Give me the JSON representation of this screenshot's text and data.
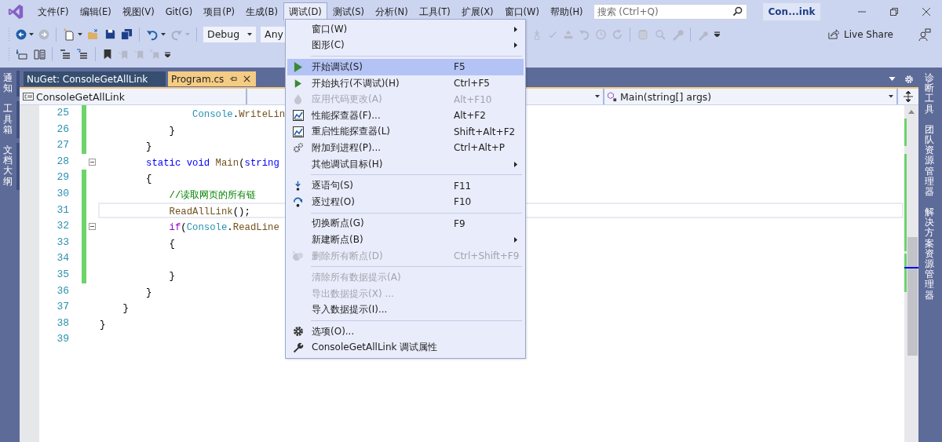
{
  "menu_bar": {
    "items": [
      {
        "label": "文件(F)",
        "selected": false
      },
      {
        "label": "编辑(E)",
        "selected": false
      },
      {
        "label": "视图(V)",
        "selected": false
      },
      {
        "label": "Git(G)",
        "selected": false
      },
      {
        "label": "项目(P)",
        "selected": false
      },
      {
        "label": "生成(B)",
        "selected": false
      },
      {
        "label": "调试(D)",
        "selected": true
      },
      {
        "label": "测试(S)",
        "selected": false
      },
      {
        "label": "分析(N)",
        "selected": false
      },
      {
        "label": "工具(T)",
        "selected": false
      },
      {
        "label": "扩展(X)",
        "selected": false
      },
      {
        "label": "窗口(W)",
        "selected": false
      },
      {
        "label": "帮助(H)",
        "selected": false
      }
    ]
  },
  "search": {
    "placeholder": "搜索 (Ctrl+Q)"
  },
  "solution_name": "Con...ink",
  "toolbar": {
    "configuration": "Debug",
    "platform": "Any",
    "live_share": "Live Share"
  },
  "left_panels": [
    "通知",
    "工具箱",
    "文档大纲"
  ],
  "right_panels": [
    "诊断工具",
    "团队资源管理器",
    "解决方案资源管理器"
  ],
  "tabs": [
    {
      "label": "NuGet: ConsoleGetAllLink",
      "selected": false
    },
    {
      "label": "Program.cs",
      "selected": true
    }
  ],
  "nav_bar": {
    "project": "ConsoleGetAllLink",
    "member": "Main(string[] args)"
  },
  "code": {
    "lines": [
      {
        "number": "25",
        "changed": true,
        "current": false,
        "fold": false,
        "tokens": [
          {
            "text": "                Console",
            "kind": "type"
          },
          {
            "text": ".",
            "kind": "plain"
          },
          {
            "text": "WriteLin",
            "kind": "method"
          }
        ]
      },
      {
        "number": "26",
        "changed": true,
        "current": false,
        "fold": false,
        "tokens": [
          {
            "text": "            }",
            "kind": "plain"
          }
        ]
      },
      {
        "number": "27",
        "changed": true,
        "current": false,
        "fold": false,
        "tokens": [
          {
            "text": "        }",
            "kind": "plain"
          }
        ]
      },
      {
        "number": "28",
        "changed": false,
        "current": false,
        "fold": true,
        "tokens": [
          {
            "text": "        static void",
            "kind": "keyword"
          },
          {
            "text": " Main",
            "kind": "method"
          },
          {
            "text": "(",
            "kind": "plain"
          },
          {
            "text": "string",
            "kind": "keyword"
          }
        ]
      },
      {
        "number": "29",
        "changed": true,
        "current": false,
        "fold": false,
        "tokens": [
          {
            "text": "        {",
            "kind": "plain"
          }
        ]
      },
      {
        "number": "30",
        "changed": true,
        "current": false,
        "fold": false,
        "tokens": [
          {
            "text": "            //读取网页的所有链",
            "kind": "comment"
          }
        ]
      },
      {
        "number": "31",
        "changed": true,
        "current": true,
        "fold": false,
        "tokens": [
          {
            "text": "            ReadAllLink",
            "kind": "method"
          },
          {
            "text": "();",
            "kind": "plain"
          }
        ]
      },
      {
        "number": "32",
        "changed": true,
        "current": false,
        "fold": true,
        "tokens": [
          {
            "text": "            if",
            "kind": "control"
          },
          {
            "text": "(",
            "kind": "plain"
          },
          {
            "text": "Console",
            "kind": "type"
          },
          {
            "text": ".",
            "kind": "plain"
          },
          {
            "text": "ReadLine",
            "kind": "method"
          }
        ]
      },
      {
        "number": "33",
        "changed": true,
        "current": false,
        "fold": false,
        "tokens": [
          {
            "text": "            {",
            "kind": "plain"
          }
        ]
      },
      {
        "number": "34",
        "changed": true,
        "current": false,
        "fold": false
      },
      {
        "number": "35",
        "changed": true,
        "current": false,
        "fold": false,
        "tokens": [
          {
            "text": "            }",
            "kind": "plain"
          }
        ]
      },
      {
        "number": "36",
        "changed": false,
        "current": false,
        "fold": false,
        "tokens": [
          {
            "text": "        }",
            "kind": "plain"
          }
        ]
      },
      {
        "number": "37",
        "changed": false,
        "current": false,
        "fold": false,
        "tokens": [
          {
            "text": "    }",
            "kind": "plain"
          }
        ]
      },
      {
        "number": "38",
        "changed": false,
        "current": false,
        "fold": false,
        "tokens": [
          {
            "text": "}",
            "kind": "plain"
          }
        ]
      },
      {
        "number": "39",
        "changed": false,
        "current": false,
        "fold": false
      }
    ]
  },
  "debug_menu": {
    "groups": [
      {
        "items": [
          {
            "label": "窗口(W)",
            "submenu": true,
            "disabled": false,
            "selected": false
          },
          {
            "label": "图形(C)",
            "submenu": true,
            "disabled": false,
            "selected": false
          }
        ]
      },
      {
        "items": [
          {
            "label": "开始调试(S)",
            "shortcut": "F5",
            "submenu": false,
            "disabled": false,
            "selected": true
          },
          {
            "label": "开始执行(不调试)(H)",
            "shortcut": "Ctrl+F5",
            "submenu": false,
            "disabled": false,
            "selected": false
          },
          {
            "label": "应用代码更改(A)",
            "shortcut": "Alt+F10",
            "submenu": false,
            "disabled": true,
            "selected": false
          },
          {
            "label": "性能探查器(F)...",
            "shortcut": "Alt+F2",
            "submenu": false,
            "disabled": false,
            "selected": false
          },
          {
            "label": "重启性能探查器(L)",
            "shortcut": "Shift+Alt+F2",
            "submenu": false,
            "disabled": false,
            "selected": false
          },
          {
            "label": "附加到进程(P)...",
            "shortcut": "Ctrl+Alt+P",
            "submenu": false,
            "disabled": false,
            "selected": false
          },
          {
            "label": "其他调试目标(H)",
            "submenu": true,
            "disabled": false,
            "selected": false
          }
        ]
      },
      {
        "items": [
          {
            "label": "逐语句(S)",
            "shortcut": "F11",
            "submenu": false,
            "disabled": false,
            "selected": false
          },
          {
            "label": "逐过程(O)",
            "shortcut": "F10",
            "submenu": false,
            "disabled": false,
            "selected": false
          }
        ]
      },
      {
        "items": [
          {
            "label": "切换断点(G)",
            "shortcut": "F9",
            "submenu": false,
            "disabled": false,
            "selected": false
          },
          {
            "label": "新建断点(B)",
            "submenu": true,
            "disabled": false,
            "selected": false
          },
          {
            "label": "删除所有断点(D)",
            "shortcut": "Ctrl+Shift+F9",
            "submenu": false,
            "disabled": true,
            "selected": false
          }
        ]
      },
      {
        "items": [
          {
            "label": "清除所有数据提示(A)",
            "submenu": false,
            "disabled": true,
            "selected": false
          },
          {
            "label": "导出数据提示(X) ...",
            "submenu": false,
            "disabled": true,
            "selected": false
          },
          {
            "label": "导入数据提示(I)...",
            "submenu": false,
            "disabled": false,
            "selected": false
          }
        ]
      },
      {
        "items": [
          {
            "label": "选项(O)...",
            "submenu": false,
            "disabled": false,
            "selected": false
          },
          {
            "label": "ConsoleGetAllLink 调试属性",
            "submenu": false,
            "disabled": false,
            "selected": false
          }
        ]
      }
    ]
  }
}
